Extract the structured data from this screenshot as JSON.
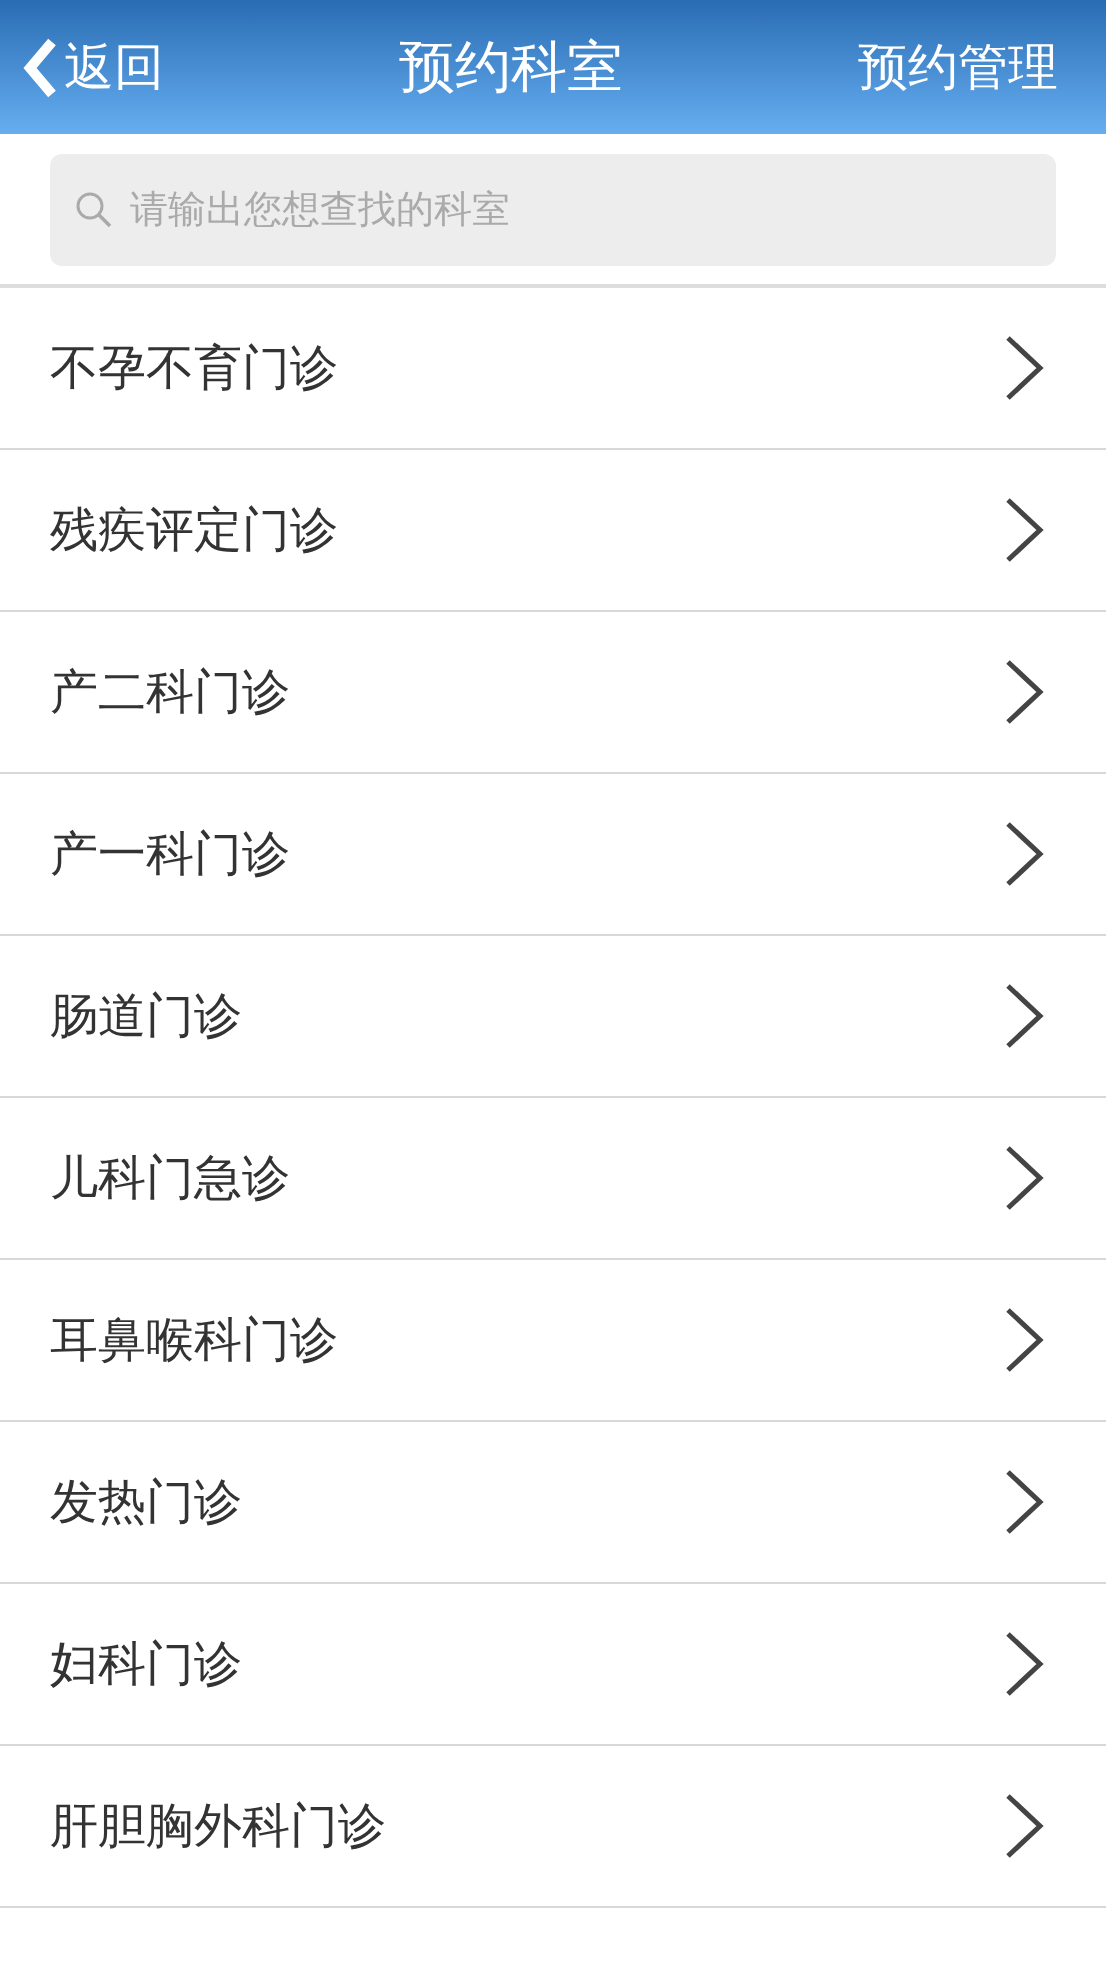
{
  "header": {
    "back": "返回",
    "title": "预约科室",
    "action": "预约管理"
  },
  "search": {
    "placeholder": "请输出您想查找的科室"
  },
  "departments": [
    {
      "name": "不孕不育门诊"
    },
    {
      "name": "残疾评定门诊"
    },
    {
      "name": "产二科门诊"
    },
    {
      "name": "产一科门诊"
    },
    {
      "name": "肠道门诊"
    },
    {
      "name": "儿科门急诊"
    },
    {
      "name": "耳鼻喉科门诊"
    },
    {
      "name": "发热门诊"
    },
    {
      "name": "妇科门诊"
    },
    {
      "name": "肝胆胸外科门诊"
    }
  ]
}
